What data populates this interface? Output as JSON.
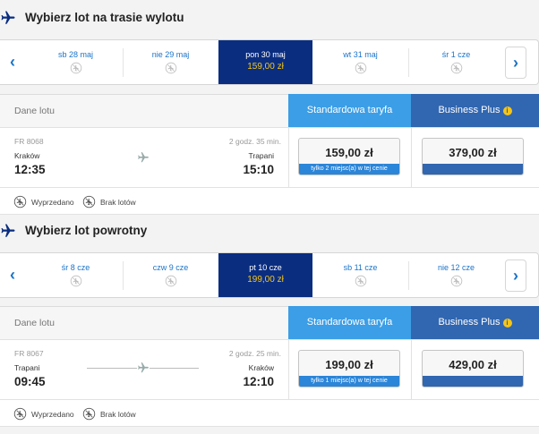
{
  "outbound": {
    "title": "Wybierz lot na trasie wylotu",
    "dates": [
      {
        "label": "sb 28 maj"
      },
      {
        "label": "nie 29 maj"
      },
      {
        "label": "pon 30 maj",
        "price": "159,00 zł"
      },
      {
        "label": "wt 31 maj"
      },
      {
        "label": "śr 1 cze"
      }
    ],
    "fare_header": {
      "details_label": "Dane lotu",
      "standard": "Standardowa taryfa",
      "business": "Business Plus"
    },
    "flight": {
      "number": "FR 8068",
      "duration": "2 godz. 35 min.",
      "from_city": "Kraków",
      "to_city": "Trapani",
      "depart": "12:35",
      "arrive": "15:10",
      "standard_price": "159,00 zł",
      "standard_note": "tylko 2 miejsc(a) w tej cenie",
      "business_price": "379,00 zł"
    },
    "legend": {
      "sold_out": "Wyprzedano",
      "no_flights": "Brak lotów"
    }
  },
  "return": {
    "title": "Wybierz lot powrotny",
    "dates": [
      {
        "label": "śr 8 cze"
      },
      {
        "label": "czw 9 cze"
      },
      {
        "label": "pt 10 cze",
        "price": "199,00 zł"
      },
      {
        "label": "sb 11 cze"
      },
      {
        "label": "nie 12 cze"
      }
    ],
    "fare_header": {
      "details_label": "Dane lotu",
      "standard": "Standardowa taryfa",
      "business": "Business Plus"
    },
    "flight": {
      "number": "FR 8067",
      "duration": "2 godz. 25 min.",
      "from_city": "Trapani",
      "to_city": "Kraków",
      "depart": "09:45",
      "arrive": "12:10",
      "standard_price": "199,00 zł",
      "standard_note": "tylko 1 miejsc(a) w tej cenie",
      "business_price": "429,00 zł"
    },
    "legend": {
      "sold_out": "Wyprzedano",
      "no_flights": "Brak lotów"
    }
  },
  "icons": {
    "section": "plane-icon",
    "date": "no-flight-icon",
    "nav_prev": "chevron-left-icon",
    "nav_next": "chevron-right-icon",
    "info": "info-icon"
  },
  "colors": {
    "accent": "#1a73c8",
    "selected_date": "#0a2d80",
    "price_highlight": "#f5c518",
    "standard_fare": "#3b9ee6",
    "business_fare": "#3166b0"
  }
}
